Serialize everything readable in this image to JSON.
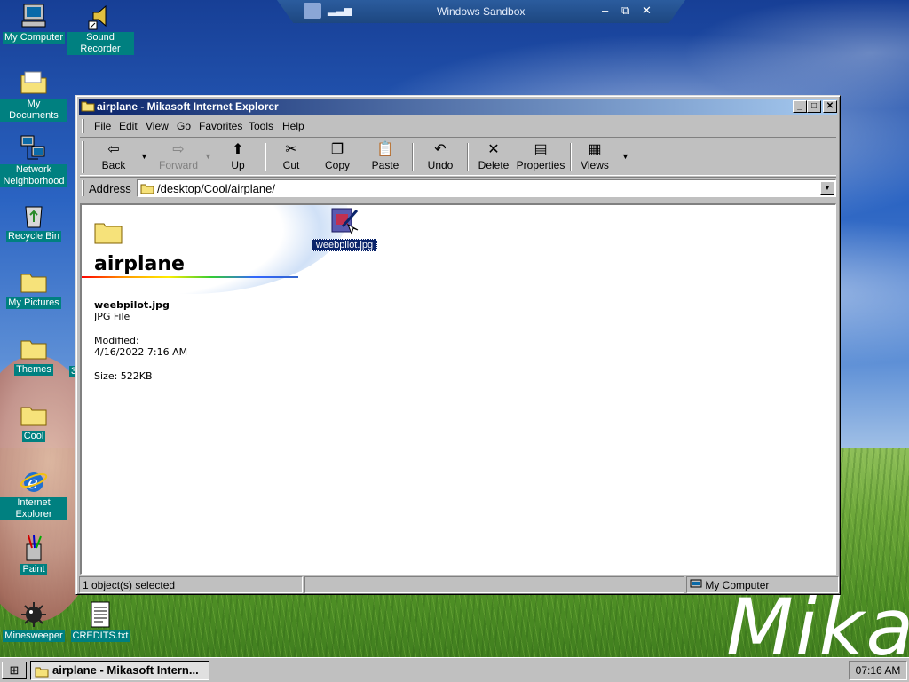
{
  "sandbox_bar": {
    "title": "Windows Sandbox",
    "minimize_glyph": "–",
    "restore_glyph": "⧉",
    "close_glyph": "✕"
  },
  "desktop": {
    "icons": [
      {
        "label": "My Computer",
        "icon": "my-computer-icon"
      },
      {
        "label": "Sound Recorder",
        "icon": "sound-recorder-icon"
      },
      {
        "label": "My Documents",
        "icon": "folder-icon"
      },
      {
        "label": "Network Neighborhood",
        "icon": "network-icon"
      },
      {
        "label": "Recycle Bin",
        "icon": "recycle-bin-icon"
      },
      {
        "label": "My Pictures",
        "icon": "folder-icon"
      },
      {
        "label": "Themes",
        "icon": "folder-icon"
      },
      {
        "label": "Cool",
        "icon": "folder-icon"
      },
      {
        "label": "Internet Explorer",
        "icon": "internet-explorer-icon"
      },
      {
        "label": "Paint",
        "icon": "paint-icon"
      },
      {
        "label": "Minesweeper",
        "icon": "minesweeper-icon"
      },
      {
        "label": "CREDITS.txt",
        "icon": "text-file-icon"
      }
    ],
    "themes_trailing": "3",
    "wallpaper_text": "Mikas"
  },
  "window": {
    "title": "airplane - Mikasoft Internet Explorer",
    "menu": [
      "File",
      "Edit",
      "View",
      "Go",
      "Favorites",
      "Tools",
      "Help"
    ],
    "toolbar": {
      "back": "Back",
      "forward": "Forward",
      "up": "Up",
      "cut": "Cut",
      "copy": "Copy",
      "paste": "Paste",
      "undo": "Undo",
      "delete": "Delete",
      "properties": "Properties",
      "views": "Views"
    },
    "address": {
      "label": "Address",
      "value": "/desktop/Cool/airplane/"
    },
    "info_panel": {
      "folder_name": "airplane",
      "file_name": "weebpilot.jpg",
      "file_type": "JPG File",
      "modified_label": "Modified:",
      "modified_value": "4/16/2022 7:16 AM",
      "size": "Size: 522KB"
    },
    "files": [
      {
        "name": "weebpilot.jpg",
        "selected": true
      }
    ],
    "status": {
      "left": "1 object(s) selected",
      "right": "My Computer"
    }
  },
  "taskbar": {
    "task": "airplane - Mikasoft Intern...",
    "clock": "07:16 AM"
  }
}
